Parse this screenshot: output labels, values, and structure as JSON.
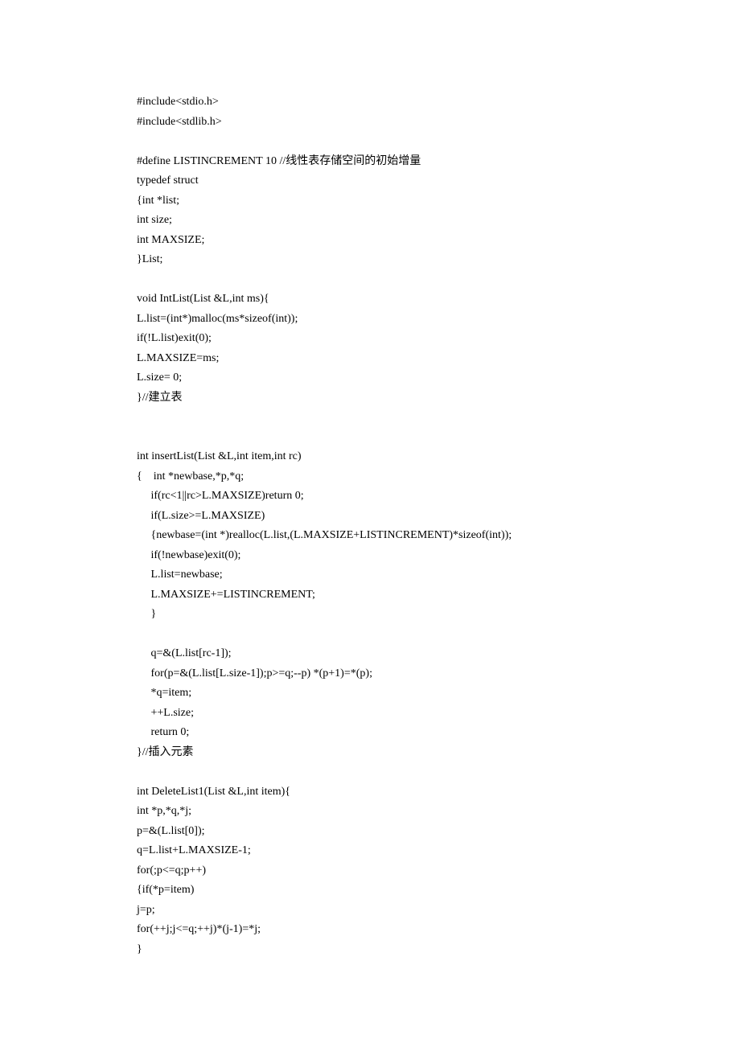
{
  "code": {
    "lines": [
      "#include<stdio.h>",
      "#include<stdlib.h>",
      "",
      "#define LISTINCREMENT 10 //线性表存储空间的初始增量",
      "typedef struct",
      "{int *list;",
      "int size;",
      "int MAXSIZE;",
      "}List;",
      "",
      "void IntList(List &L,int ms){",
      "L.list=(int*)malloc(ms*sizeof(int));",
      "if(!L.list)exit(0);",
      "L.MAXSIZE=ms;",
      "L.size= 0;",
      "}//建立表",
      "",
      "",
      "int insertList(List &L,int item,int rc)",
      "{    int *newbase,*p,*q;",
      "     if(rc<1||rc>L.MAXSIZE)return 0;",
      "     if(L.size>=L.MAXSIZE)",
      "     {newbase=(int *)realloc(L.list,(L.MAXSIZE+LISTINCREMENT)*sizeof(int));",
      "     if(!newbase)exit(0);",
      "     L.list=newbase;",
      "     L.MAXSIZE+=LISTINCREMENT;",
      "     }",
      "",
      "     q=&(L.list[rc-1]);",
      "     for(p=&(L.list[L.size-1]);p>=q;--p) *(p+1)=*(p);",
      "     *q=item;",
      "     ++L.size;",
      "     return 0;",
      "}//插入元素",
      "",
      "int DeleteList1(List &L,int item){",
      "int *p,*q,*j;",
      "p=&(L.list[0]);",
      "q=L.list+L.MAXSIZE-1;",
      "for(;p<=q;p++)",
      "{if(*p=item)",
      "j=p;",
      "for(++j;j<=q;++j)*(j-1)=*j;",
      "}"
    ]
  }
}
